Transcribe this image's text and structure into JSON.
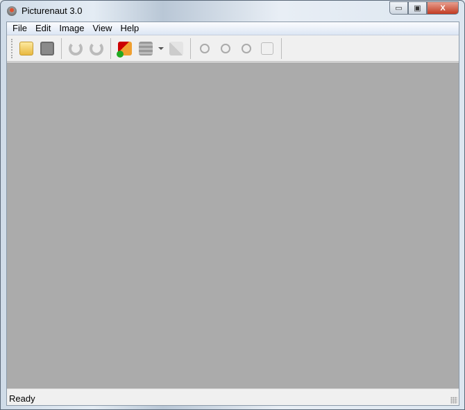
{
  "window": {
    "title": "Picturenaut 3.0",
    "minimize": "▭",
    "maximize": "▣",
    "close": "X"
  },
  "menu": [
    "File",
    "Edit",
    "Image",
    "View",
    "Help"
  ],
  "toolbar": [
    "open-folder",
    "save",
    "rotate-left",
    "rotate-right",
    "add-image",
    "adjust",
    "dropdown",
    "export",
    "zoom-in",
    "zoom-out",
    "zoom-reset",
    "zoom-fit"
  ],
  "status": {
    "text": "Ready"
  },
  "colors": {
    "canvas": "#ababab"
  }
}
